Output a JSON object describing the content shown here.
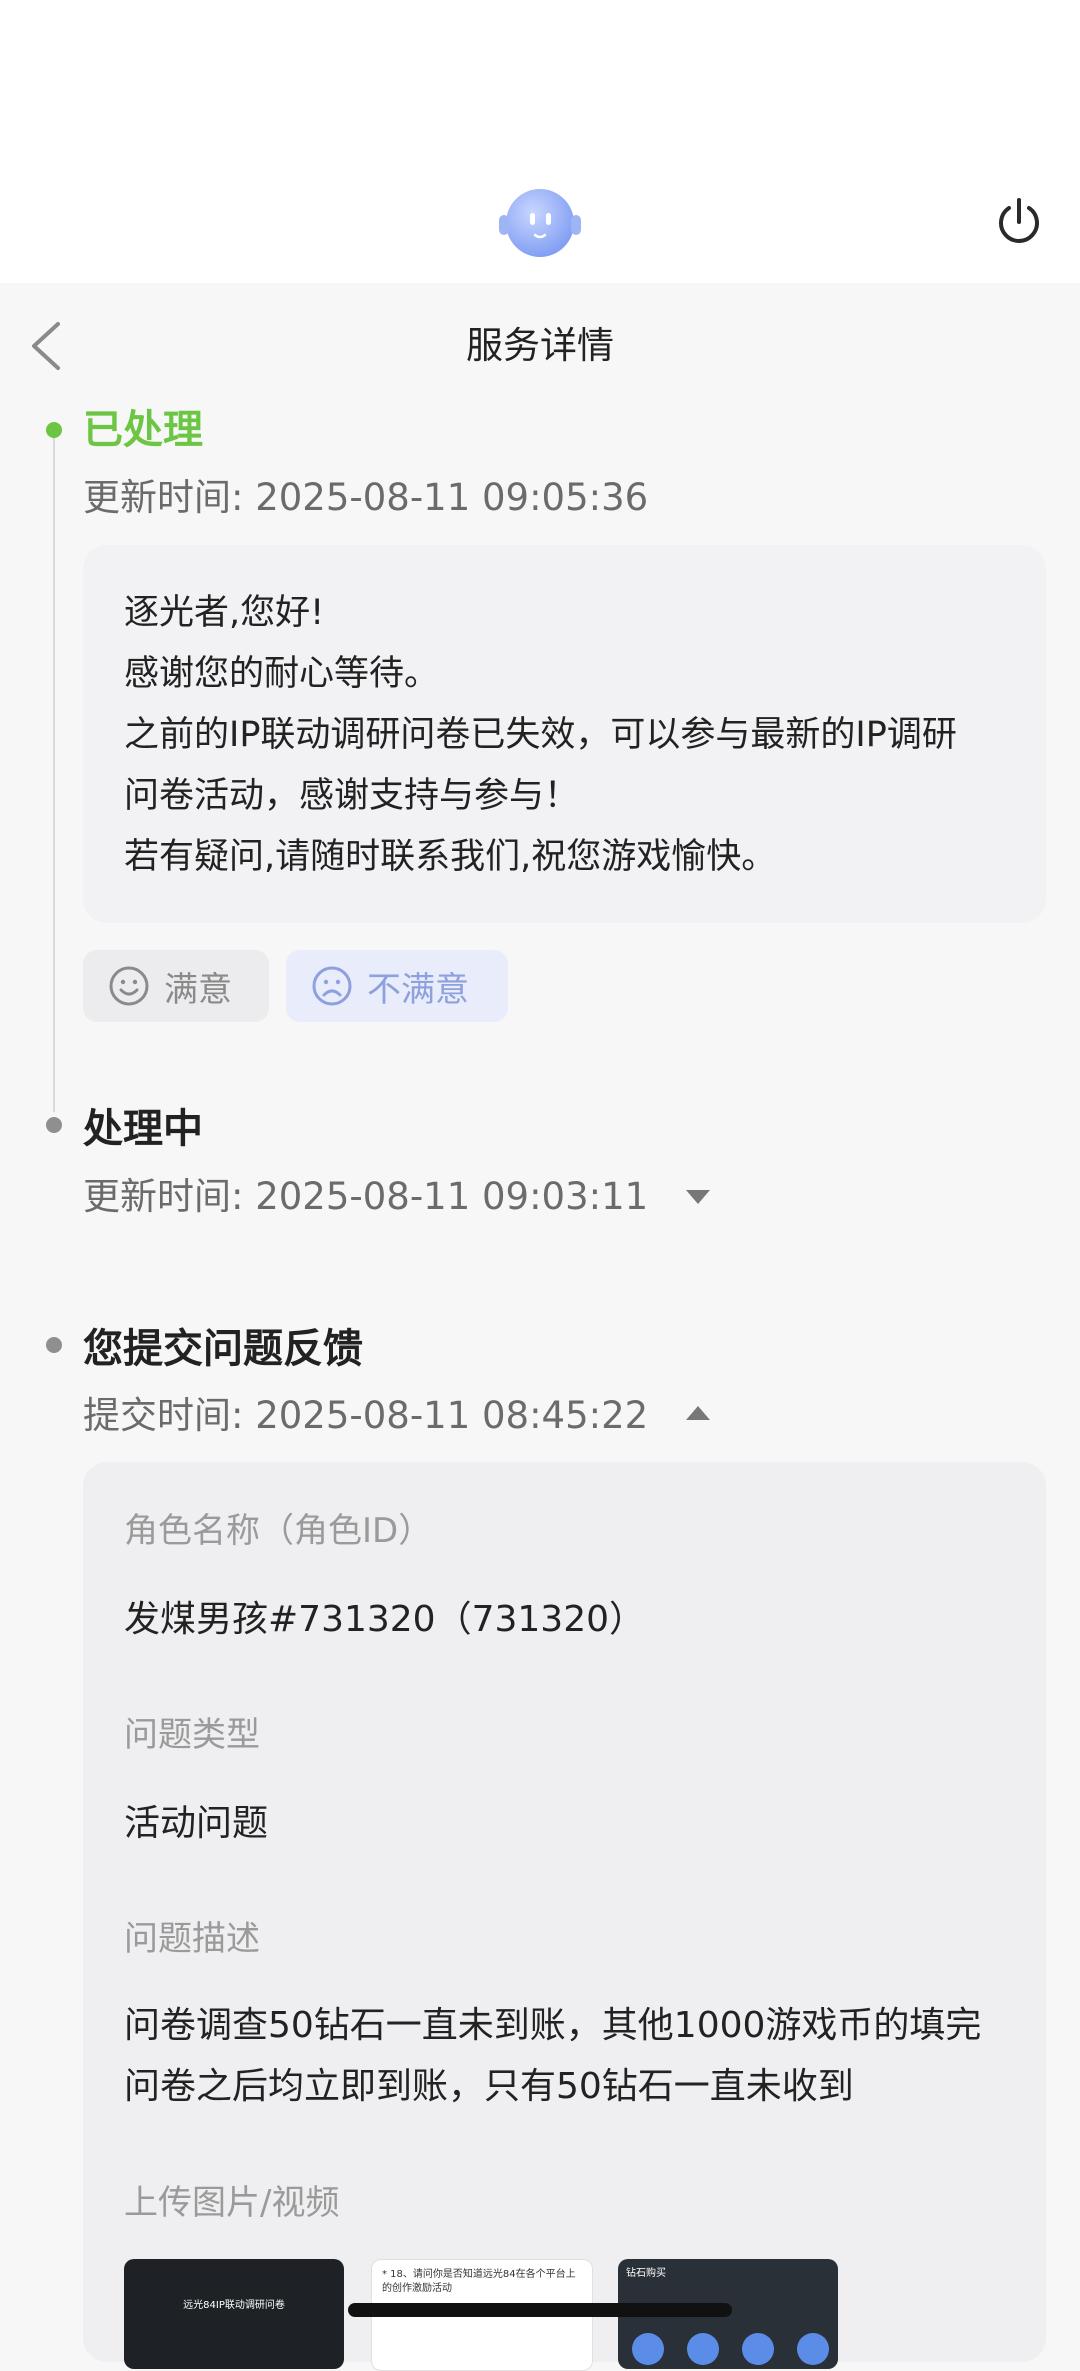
{
  "nav": {
    "title": "服务详情"
  },
  "steps": [
    {
      "title": "已处理",
      "time": "更新时间: 2025-08-11 09:05:36",
      "status_color": "#6cc644",
      "reply_lines": [
        "逐光者,您好!",
        "感谢您的耐心等待。",
        "之前的IP联动调研问卷已失效，可以参与最新的IP调研",
        "问卷活动，感谢支持与参与！",
        "若有疑问,请随时联系我们,祝您游戏愉快。"
      ],
      "rating": {
        "satisfied": "满意",
        "unsatisfied": "不满意"
      }
    },
    {
      "title": "处理中",
      "time": "更新时间: 2025-08-11 09:03:11"
    },
    {
      "title": "您提交问题反馈",
      "time": "提交时间: 2025-08-11 08:45:22",
      "fields": [
        {
          "label": "角色名称（角色ID）",
          "value": "发煤男孩#731320（731320）"
        },
        {
          "label": "问题类型",
          "value": "活动问题"
        },
        {
          "label": "问题描述",
          "value_lines": [
            "问卷调查50钻石一直未到账，其他1000游戏币的填完",
            "问卷之后均立即到账，只有50钻石一直未收到"
          ]
        },
        {
          "label": "上传图片/视频"
        }
      ],
      "thumbnails": [
        {
          "icon": "screenshot-thumbnail",
          "caption": "远光84IP联动调研问卷"
        },
        {
          "icon": "screenshot-thumbnail",
          "caption": "* 18、请问你是否知道远光84在各个平台上的创作激励活动"
        },
        {
          "icon": "screenshot-thumbnail",
          "caption": "钻石购买"
        }
      ]
    }
  ]
}
